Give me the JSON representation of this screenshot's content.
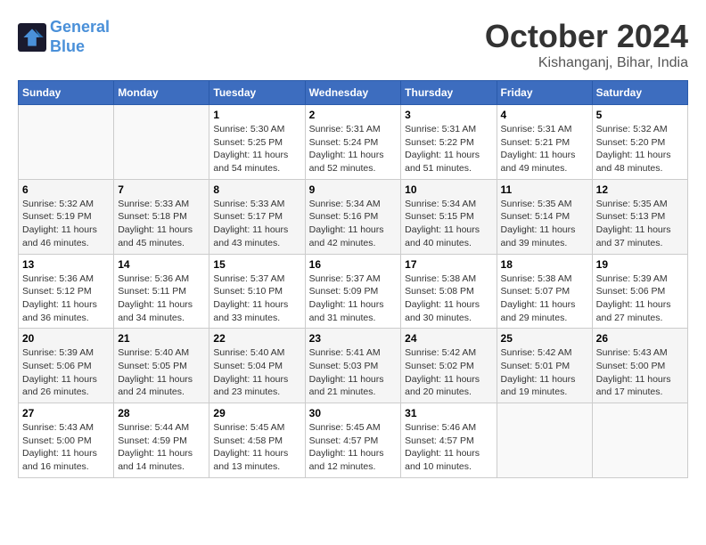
{
  "header": {
    "logo_line1": "General",
    "logo_line2": "Blue",
    "month": "October 2024",
    "location": "Kishanganj, Bihar, India"
  },
  "weekdays": [
    "Sunday",
    "Monday",
    "Tuesday",
    "Wednesday",
    "Thursday",
    "Friday",
    "Saturday"
  ],
  "weeks": [
    [
      {
        "day": "",
        "info": ""
      },
      {
        "day": "",
        "info": ""
      },
      {
        "day": "1",
        "info": "Sunrise: 5:30 AM\nSunset: 5:25 PM\nDaylight: 11 hours and 54 minutes."
      },
      {
        "day": "2",
        "info": "Sunrise: 5:31 AM\nSunset: 5:24 PM\nDaylight: 11 hours and 52 minutes."
      },
      {
        "day": "3",
        "info": "Sunrise: 5:31 AM\nSunset: 5:22 PM\nDaylight: 11 hours and 51 minutes."
      },
      {
        "day": "4",
        "info": "Sunrise: 5:31 AM\nSunset: 5:21 PM\nDaylight: 11 hours and 49 minutes."
      },
      {
        "day": "5",
        "info": "Sunrise: 5:32 AM\nSunset: 5:20 PM\nDaylight: 11 hours and 48 minutes."
      }
    ],
    [
      {
        "day": "6",
        "info": "Sunrise: 5:32 AM\nSunset: 5:19 PM\nDaylight: 11 hours and 46 minutes."
      },
      {
        "day": "7",
        "info": "Sunrise: 5:33 AM\nSunset: 5:18 PM\nDaylight: 11 hours and 45 minutes."
      },
      {
        "day": "8",
        "info": "Sunrise: 5:33 AM\nSunset: 5:17 PM\nDaylight: 11 hours and 43 minutes."
      },
      {
        "day": "9",
        "info": "Sunrise: 5:34 AM\nSunset: 5:16 PM\nDaylight: 11 hours and 42 minutes."
      },
      {
        "day": "10",
        "info": "Sunrise: 5:34 AM\nSunset: 5:15 PM\nDaylight: 11 hours and 40 minutes."
      },
      {
        "day": "11",
        "info": "Sunrise: 5:35 AM\nSunset: 5:14 PM\nDaylight: 11 hours and 39 minutes."
      },
      {
        "day": "12",
        "info": "Sunrise: 5:35 AM\nSunset: 5:13 PM\nDaylight: 11 hours and 37 minutes."
      }
    ],
    [
      {
        "day": "13",
        "info": "Sunrise: 5:36 AM\nSunset: 5:12 PM\nDaylight: 11 hours and 36 minutes."
      },
      {
        "day": "14",
        "info": "Sunrise: 5:36 AM\nSunset: 5:11 PM\nDaylight: 11 hours and 34 minutes."
      },
      {
        "day": "15",
        "info": "Sunrise: 5:37 AM\nSunset: 5:10 PM\nDaylight: 11 hours and 33 minutes."
      },
      {
        "day": "16",
        "info": "Sunrise: 5:37 AM\nSunset: 5:09 PM\nDaylight: 11 hours and 31 minutes."
      },
      {
        "day": "17",
        "info": "Sunrise: 5:38 AM\nSunset: 5:08 PM\nDaylight: 11 hours and 30 minutes."
      },
      {
        "day": "18",
        "info": "Sunrise: 5:38 AM\nSunset: 5:07 PM\nDaylight: 11 hours and 29 minutes."
      },
      {
        "day": "19",
        "info": "Sunrise: 5:39 AM\nSunset: 5:06 PM\nDaylight: 11 hours and 27 minutes."
      }
    ],
    [
      {
        "day": "20",
        "info": "Sunrise: 5:39 AM\nSunset: 5:06 PM\nDaylight: 11 hours and 26 minutes."
      },
      {
        "day": "21",
        "info": "Sunrise: 5:40 AM\nSunset: 5:05 PM\nDaylight: 11 hours and 24 minutes."
      },
      {
        "day": "22",
        "info": "Sunrise: 5:40 AM\nSunset: 5:04 PM\nDaylight: 11 hours and 23 minutes."
      },
      {
        "day": "23",
        "info": "Sunrise: 5:41 AM\nSunset: 5:03 PM\nDaylight: 11 hours and 21 minutes."
      },
      {
        "day": "24",
        "info": "Sunrise: 5:42 AM\nSunset: 5:02 PM\nDaylight: 11 hours and 20 minutes."
      },
      {
        "day": "25",
        "info": "Sunrise: 5:42 AM\nSunset: 5:01 PM\nDaylight: 11 hours and 19 minutes."
      },
      {
        "day": "26",
        "info": "Sunrise: 5:43 AM\nSunset: 5:00 PM\nDaylight: 11 hours and 17 minutes."
      }
    ],
    [
      {
        "day": "27",
        "info": "Sunrise: 5:43 AM\nSunset: 5:00 PM\nDaylight: 11 hours and 16 minutes."
      },
      {
        "day": "28",
        "info": "Sunrise: 5:44 AM\nSunset: 4:59 PM\nDaylight: 11 hours and 14 minutes."
      },
      {
        "day": "29",
        "info": "Sunrise: 5:45 AM\nSunset: 4:58 PM\nDaylight: 11 hours and 13 minutes."
      },
      {
        "day": "30",
        "info": "Sunrise: 5:45 AM\nSunset: 4:57 PM\nDaylight: 11 hours and 12 minutes."
      },
      {
        "day": "31",
        "info": "Sunrise: 5:46 AM\nSunset: 4:57 PM\nDaylight: 11 hours and 10 minutes."
      },
      {
        "day": "",
        "info": ""
      },
      {
        "day": "",
        "info": ""
      }
    ]
  ]
}
